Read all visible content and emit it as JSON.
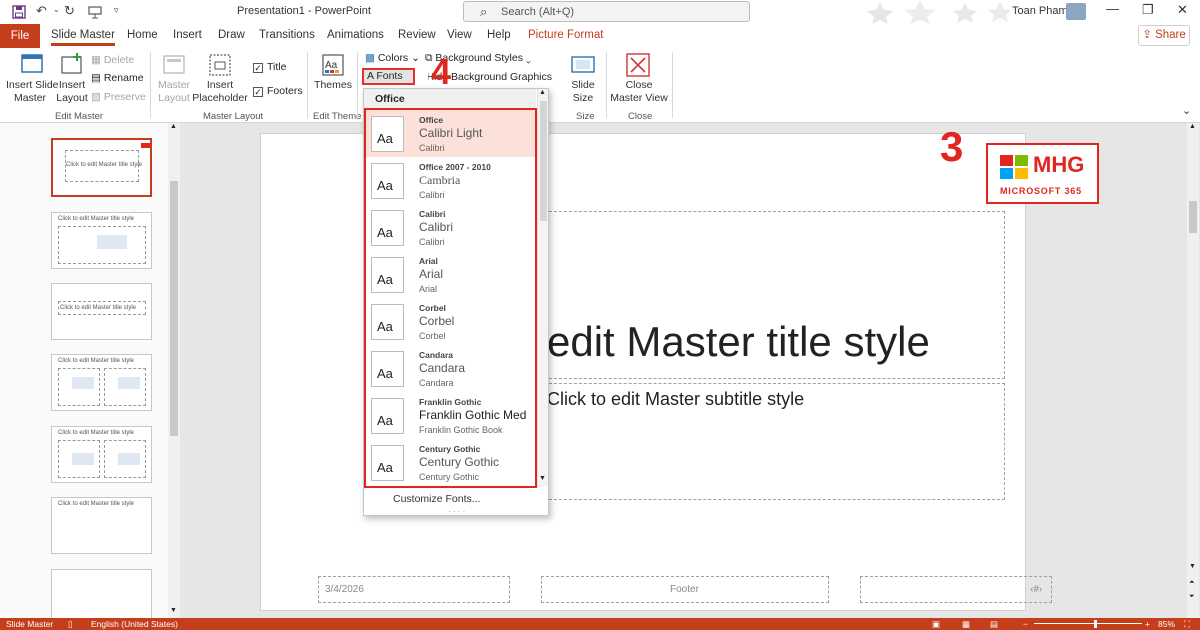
{
  "titlebar": {
    "title": "Presentation1  -  PowerPoint",
    "search_placeholder": "Search (Alt+Q)",
    "user_name": "Toan Pham"
  },
  "tabs": {
    "file": "File",
    "items": [
      "Slide Master",
      "Home",
      "Insert",
      "Draw",
      "Transitions",
      "Animations",
      "Review",
      "View",
      "Help",
      "Picture Format"
    ],
    "share": "Share"
  },
  "ribbon": {
    "insert_slide_master": [
      "Insert Slide",
      "Master"
    ],
    "insert_layout": [
      "Insert",
      "Layout"
    ],
    "delete": "Delete",
    "rename": "Rename",
    "preserve": "Preserve",
    "master_layout": [
      "Master",
      "Layout"
    ],
    "insert_placeholder": [
      "Insert",
      "Placeholder"
    ],
    "title_chk": "Title",
    "footers_chk": "Footers",
    "themes": "Themes",
    "colors": "Colors",
    "fonts": "Fonts",
    "background_styles": "Background Styles",
    "hide_background_graphics": "Hide Background Graphics",
    "slide_size": [
      "Slide",
      "Size"
    ],
    "close_master_view": [
      "Close",
      "Master View"
    ],
    "groups": {
      "edit_master": "Edit Master",
      "master_layout": "Master Layout",
      "edit_theme": "Edit Theme",
      "size": "Size",
      "close": "Close"
    }
  },
  "annotations": {
    "num3": "3",
    "num4": "4"
  },
  "thumbnail_title": "Click to edit Master title style",
  "slide": {
    "title": "edit Master title style",
    "subtitle": "Click to edit Master subtitle style",
    "date": "3/4/2026",
    "footer": "Footer",
    "page_num": "‹#›"
  },
  "logo": {
    "brand": "MHG",
    "sub": "MICROSOFT 365"
  },
  "fonts_dropdown": {
    "header": "Office",
    "items": [
      {
        "name": "Office",
        "heading": "Calibri Light",
        "body": "Calibri"
      },
      {
        "name": "Office 2007 - 2010",
        "heading": "Cambria",
        "body": "Calibri"
      },
      {
        "name": "Calibri",
        "heading": "Calibri",
        "body": "Calibri"
      },
      {
        "name": "Arial",
        "heading": "Arial",
        "body": "Arial"
      },
      {
        "name": "Corbel",
        "heading": "Corbel",
        "body": "Corbel"
      },
      {
        "name": "Candara",
        "heading": "Candara",
        "body": "Candara"
      },
      {
        "name": "Franklin Gothic",
        "heading": "Franklin Gothic Med",
        "body": "Franklin Gothic Book"
      },
      {
        "name": "Century Gothic",
        "heading": "Century Gothic",
        "body": "Century Gothic"
      }
    ],
    "preview_glyph": "Aa",
    "customize": "Customize Fonts...",
    "dots": "· · · ·"
  },
  "statusbar": {
    "view": "Slide Master",
    "language": "English (United States)",
    "zoom": "85%"
  },
  "colors": {
    "accent": "#c43e1c",
    "annotation_red": "#e0261f"
  }
}
